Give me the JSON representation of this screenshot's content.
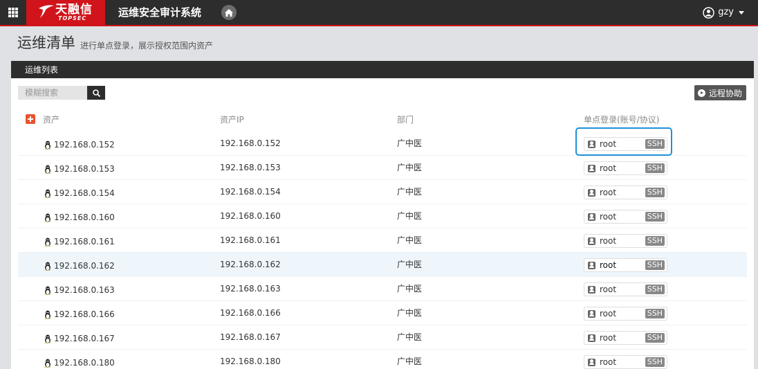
{
  "topbar": {
    "brand_cn": "天融信",
    "brand_en": "TOPSEC",
    "system_title": "运维安全审计系统",
    "username": "gzy"
  },
  "page": {
    "title": "运维清单",
    "subtitle": "进行单点登录，展示授权范围内资产"
  },
  "panel": {
    "title": "运维列表",
    "search_placeholder": "模糊搜索",
    "remote_assist_label": "远程协助"
  },
  "table": {
    "columns": [
      "资产",
      "资产IP",
      "部门",
      "单点登录(账号/协议)"
    ],
    "rows": [
      {
        "asset": "192.168.0.152",
        "ip": "192.168.0.152",
        "dept": "广中医",
        "account": "root",
        "protocol": "SSH"
      },
      {
        "asset": "192.168.0.153",
        "ip": "192.168.0.153",
        "dept": "广中医",
        "account": "root",
        "protocol": "SSH"
      },
      {
        "asset": "192.168.0.154",
        "ip": "192.168.0.154",
        "dept": "广中医",
        "account": "root",
        "protocol": "SSH"
      },
      {
        "asset": "192.168.0.160",
        "ip": "192.168.0.160",
        "dept": "广中医",
        "account": "root",
        "protocol": "SSH"
      },
      {
        "asset": "192.168.0.161",
        "ip": "192.168.0.161",
        "dept": "广中医",
        "account": "root",
        "protocol": "SSH"
      },
      {
        "asset": "192.168.0.162",
        "ip": "192.168.0.162",
        "dept": "广中医",
        "account": "root",
        "protocol": "SSH"
      },
      {
        "asset": "192.168.0.163",
        "ip": "192.168.0.163",
        "dept": "广中医",
        "account": "root",
        "protocol": "SSH"
      },
      {
        "asset": "192.168.0.166",
        "ip": "192.168.0.166",
        "dept": "广中医",
        "account": "root",
        "protocol": "SSH"
      },
      {
        "asset": "192.168.0.167",
        "ip": "192.168.0.167",
        "dept": "广中医",
        "account": "root",
        "protocol": "SSH"
      },
      {
        "asset": "192.168.0.180",
        "ip": "192.168.0.180",
        "dept": "广中医",
        "account": "root",
        "protocol": "SSH"
      }
    ],
    "highlighted_row": 5,
    "focused_row": 0
  },
  "colors": {
    "brand_red": "#d1141b",
    "topbar_bg": "#2d2d2d",
    "focus_blue": "#1e90d8",
    "add_orange": "#e8532f"
  },
  "icons": {
    "app_grid": "grid-icon",
    "home": "home-icon",
    "user": "user-circle-icon",
    "search": "search-icon",
    "remote": "play-circle-icon",
    "asset_os": "linux-penguin-icon",
    "account": "user-card-icon"
  }
}
